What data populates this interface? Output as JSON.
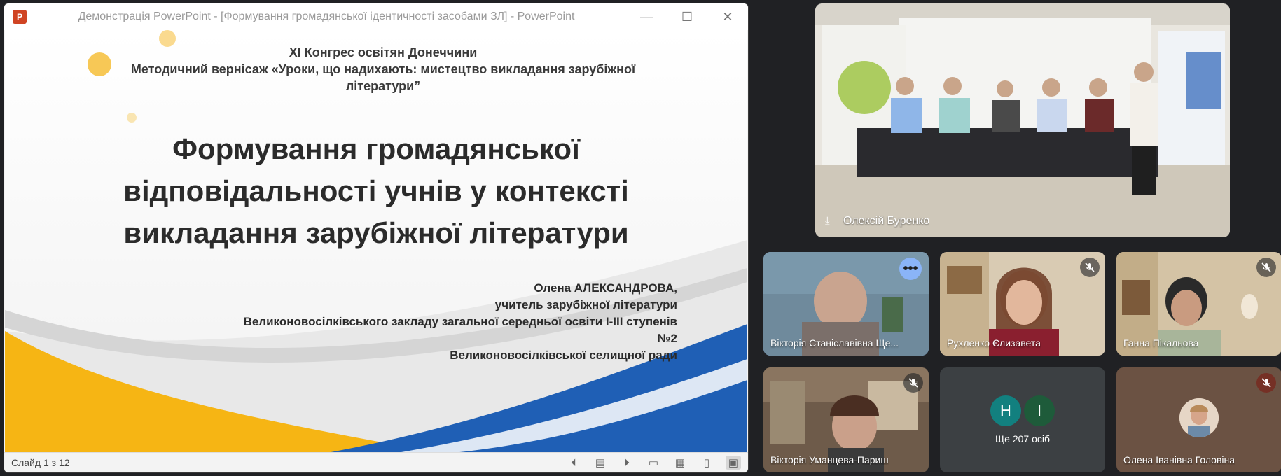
{
  "ppt": {
    "logo": "P",
    "title": "Демонстрація PowerPoint - [Формування громадянської ідентичності засобами ЗЛ] - PowerPoint",
    "buttons": {
      "minimize": "—",
      "maximize": "☐",
      "close": "✕"
    },
    "slide": {
      "header_line1": "XI Конгрес освітян Донеччини",
      "header_line2": "Методичний вернісаж «Уроки, що надихають: мистецтво викладання зарубіжної літератури”",
      "title": "Формування громадянської відповідальності учнів у контексті викладання зарубіжної літератури",
      "author_name": "Олена АЛЕКСАНДРОВА,",
      "author_role": "учитель зарубіжної літератури",
      "author_school": "Великоновосілківського закладу загальної середньої освіти І-ІІІ ступенів",
      "author_number": "№2",
      "author_council": "Великоновосілківської селищної ради"
    },
    "status": {
      "slide_counter": "Слайд 1 з 12",
      "icons": [
        "previous-icon",
        "slides-icon",
        "next-icon",
        "normal-view-icon",
        "slide-sorter-icon",
        "reading-view-icon",
        "slideshow-icon"
      ]
    }
  },
  "meeting": {
    "presenter": {
      "name": "Олексій Буренко"
    },
    "participants": [
      {
        "name": "Вікторія Станіславівна Ще...",
        "more": "•••"
      },
      {
        "name": "Рухленко Єлизавета"
      },
      {
        "name": "Ганна Пікальова"
      },
      {
        "name": "Вікторія Уманцева-Париш"
      },
      {
        "name": "Ще 207 осіб",
        "initials": [
          "Н",
          "І"
        ]
      },
      {
        "name": "Олена Іванівна Головіна"
      }
    ]
  },
  "colors": {
    "meeting_bg": "#202124",
    "tile_bg": "#3c4043",
    "active_border": "#8ab4f8",
    "slide_yellow": "#f6b514",
    "slide_blue": "#1f5fb5",
    "avatar_teal": "#12807f",
    "avatar_green": "#1e5b3a"
  }
}
